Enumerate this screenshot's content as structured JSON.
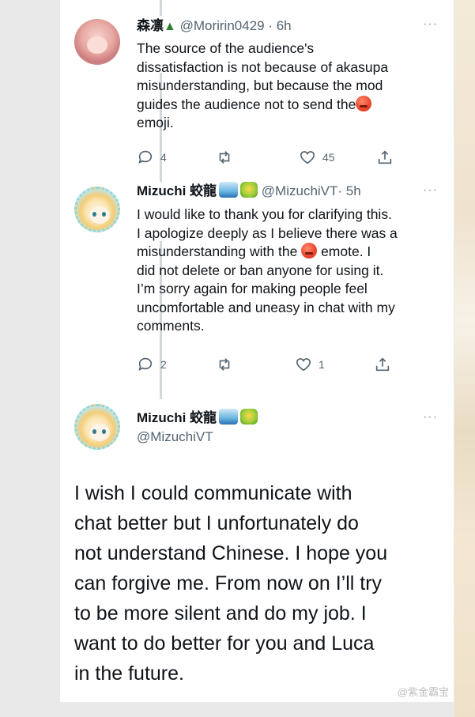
{
  "tweets": [
    {
      "display_name": "森凛",
      "handle": "@Moririn0429",
      "time": "· 6h",
      "more": "···",
      "text_lines": [
        "The source of the audience's",
        "dissatisfaction is not because of akasupa",
        "misunderstanding, but because the mod",
        "guides the audience not to send the",
        "emoji."
      ],
      "stats": {
        "replies": "4",
        "retweets": "",
        "likes": "45"
      }
    },
    {
      "display_name": "Mizuchi 蛟龍",
      "handle": "@MizuchiVT",
      "time": "· 5h",
      "more": "···",
      "text_lines": [
        "I would like to thank you for clarifying this.",
        "I apologize deeply as I believe there was a",
        "misunderstanding with the",
        "emote. I",
        "did not delete or ban anyone for using it.",
        "I’m sorry again for making people feel",
        "uncomfortable and uneasy in chat with my",
        "comments."
      ],
      "stats": {
        "replies": "2",
        "retweets": "",
        "likes": "1"
      }
    },
    {
      "display_name": "Mizuchi 蛟龍",
      "handle": "@MizuchiVT",
      "more": "···",
      "text_lines": [
        "I wish I could communicate with",
        "chat better but I unfortunately do",
        "not understand Chinese. I hope you",
        "can forgive me. From now on I’ll try",
        "to be more silent and do my job. I",
        "want to do better for you and Luca",
        "in the future."
      ]
    }
  ],
  "watermark": "@紫金霸宝",
  "icons": {
    "reply": "reply-icon",
    "retweet": "retweet-icon",
    "like": "heart-icon",
    "share": "share-icon",
    "tree": "evergreen-tree-emoji",
    "angry": "angry-face-emoji",
    "wave": "wave-emoji",
    "dragon": "dragon-emoji"
  }
}
